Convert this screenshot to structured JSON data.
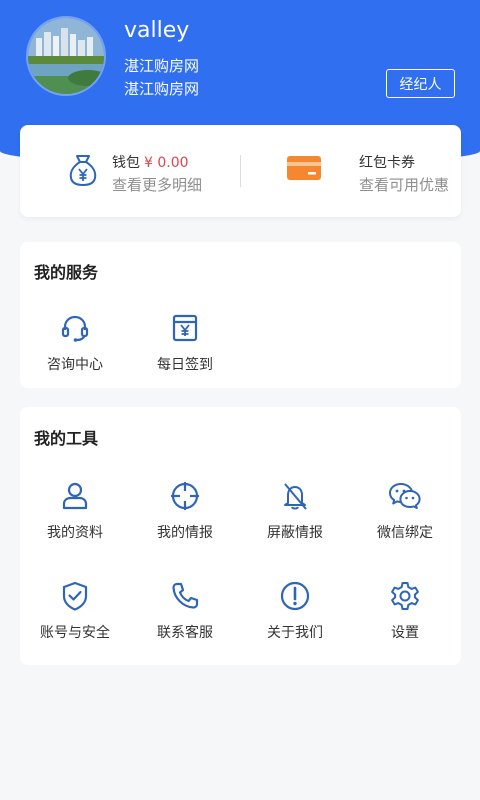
{
  "profile": {
    "username": "valley",
    "subtitle_line1": "湛江购房网",
    "subtitle_line2": "湛江购房网",
    "agent_button": "经纪人",
    "avatar_icon": "city-lake-photo"
  },
  "wallet": {
    "title": "钱包",
    "amount": "¥ 0.00",
    "desc": "查看更多明细",
    "icon": "money-bag-icon"
  },
  "coupon": {
    "title": "红包卡券",
    "desc": "查看可用优惠",
    "icon": "card-icon"
  },
  "services": {
    "title": "我的服务",
    "items": [
      {
        "label": "咨询中心",
        "icon": "headset-icon"
      },
      {
        "label": "每日签到",
        "icon": "calendar-yen-icon"
      }
    ]
  },
  "tools": {
    "title": "我的工具",
    "items": [
      {
        "label": "我的资料",
        "icon": "user-icon"
      },
      {
        "label": "我的情报",
        "icon": "crosshair-icon"
      },
      {
        "label": "屏蔽情报",
        "icon": "bell-off-icon"
      },
      {
        "label": "微信绑定",
        "icon": "wechat-icon"
      },
      {
        "label": "账号与安全",
        "icon": "shield-check-icon"
      },
      {
        "label": "联系客服",
        "icon": "phone-icon"
      },
      {
        "label": "关于我们",
        "icon": "info-icon"
      },
      {
        "label": "设置",
        "icon": "gear-icon"
      }
    ]
  },
  "colors": {
    "header_blue": "#2f6ff0",
    "icon_blue": "#2e65b8",
    "money_red": "#e0434b",
    "card_orange": "#f5872e"
  }
}
